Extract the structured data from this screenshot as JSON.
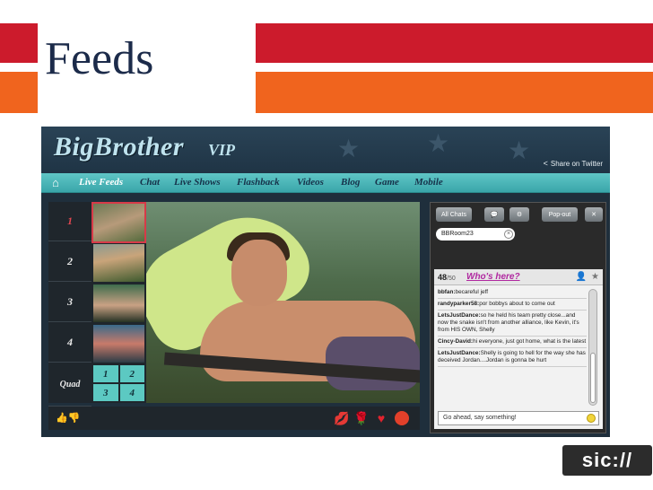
{
  "slide": {
    "title": "Feeds",
    "colors": {
      "red": "#cc1b2c",
      "orange": "#f0641e",
      "title": "#1c2b4a"
    }
  },
  "app": {
    "logo": "BigBrother",
    "logo_suffix": "VIP",
    "share_label": "Share on Twitter",
    "nav": [
      {
        "label": "Live Feeds",
        "active": true
      },
      {
        "label": "Chat"
      },
      {
        "label": "Live Shows"
      },
      {
        "label": "Flashback"
      },
      {
        "label": "Videos"
      },
      {
        "label": "Blog"
      },
      {
        "label": "Game"
      },
      {
        "label": "Mobile"
      }
    ],
    "channels": [
      "1",
      "2",
      "3",
      "4"
    ],
    "quad_label": "Quad",
    "quad_cells": [
      "1",
      "2",
      "3",
      "4"
    ],
    "icons": {
      "home": "home-icon",
      "thumbs": "thumbs-up-down-icon",
      "reactions": [
        "lips-icon",
        "rose-icon",
        "heart-icon",
        "tomato-icon"
      ]
    }
  },
  "chat": {
    "buttons": {
      "all_chats": "All Chats",
      "popout": "Pop-out"
    },
    "room_tag": "BBRoom23",
    "count": "48",
    "count_of": "/50",
    "who_label": "Who's here?",
    "messages": [
      {
        "user": "bbfan:",
        "text": "becareful jeff"
      },
      {
        "user": "randyparker58:",
        "text": "por bobbys about to come out"
      },
      {
        "user": "LetsJustDance:",
        "text": "so he held his team pretty close...and now the snake isn't from another alliance, like Kevin, it's from HIS OWN, Shelly"
      },
      {
        "user": "Cincy-David:",
        "text": "hi everyone, just got home, what is the latest"
      },
      {
        "user": "LetsJustDance:",
        "text": "Shelly is going to hell for the way she has deceived Jordan....Jordan is gonna be hurt"
      }
    ],
    "input_placeholder": "Go ahead, say something!"
  },
  "brand": {
    "logo": "sic://"
  }
}
